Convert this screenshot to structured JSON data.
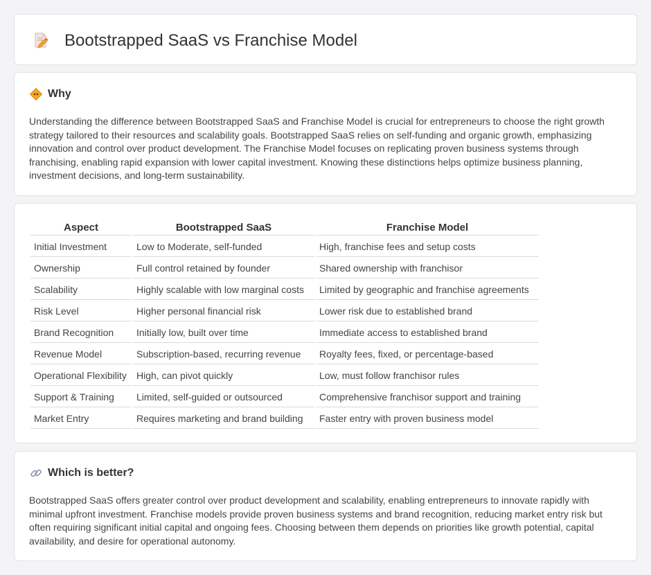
{
  "header": {
    "title": "Bootstrapped SaaS vs Franchise Model",
    "icon": "document-pencil-icon"
  },
  "why": {
    "heading": "Why",
    "icon": "diamond-sign-icon",
    "text": "Understanding the difference between Bootstrapped SaaS and Franchise Model is crucial for entrepreneurs to choose the right growth strategy tailored to their resources and scalability goals. Bootstrapped SaaS relies on self-funding and organic growth, emphasizing innovation and control over product development. The Franchise Model focuses on replicating proven business systems through franchising, enabling rapid expansion with lower capital investment. Knowing these distinctions helps optimize business planning, investment decisions, and long-term sustainability."
  },
  "table": {
    "headers": [
      "Aspect",
      "Bootstrapped SaaS",
      "Franchise Model"
    ],
    "rows": [
      [
        "Initial Investment",
        "Low to Moderate, self-funded",
        "High, franchise fees and setup costs"
      ],
      [
        "Ownership",
        "Full control retained by founder",
        "Shared ownership with franchisor"
      ],
      [
        "Scalability",
        "Highly scalable with low marginal costs",
        "Limited by geographic and franchise agreements"
      ],
      [
        "Risk Level",
        "Higher personal financial risk",
        "Lower risk due to established brand"
      ],
      [
        "Brand Recognition",
        "Initially low, built over time",
        "Immediate access to established brand"
      ],
      [
        "Revenue Model",
        "Subscription-based, recurring revenue",
        "Royalty fees, fixed, or percentage-based"
      ],
      [
        "Operational Flexibility",
        "High, can pivot quickly",
        "Low, must follow franchisor rules"
      ],
      [
        "Support & Training",
        "Limited, self-guided or outsourced",
        "Comprehensive franchisor support and training"
      ],
      [
        "Market Entry",
        "Requires marketing and brand building",
        "Faster entry with proven business model"
      ]
    ]
  },
  "better": {
    "heading": "Which is better?",
    "icon": "link-icon",
    "text": "Bootstrapped SaaS offers greater control over product development and scalability, enabling entrepreneurs to innovate rapidly with minimal upfront investment. Franchise models provide proven business systems and brand recognition, reducing market entry risk but often requiring significant initial capital and ongoing fees. Choosing between them depends on priorities like growth potential, capital availability, and desire for operational autonomy."
  },
  "colors": {
    "accent_orange": "#f0a030",
    "icon_red": "#e8604a",
    "border": "#e2e2e6"
  }
}
